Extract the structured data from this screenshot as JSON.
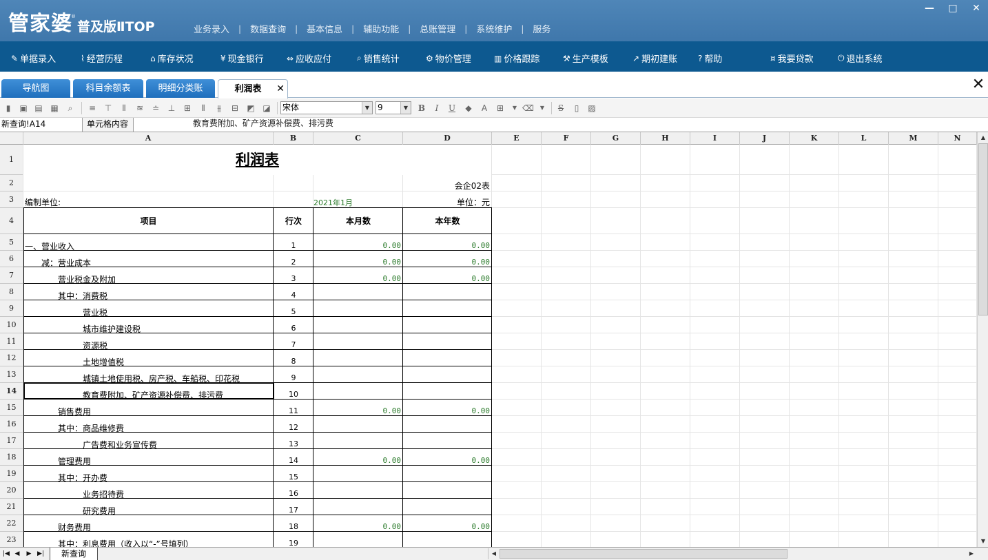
{
  "app": {
    "logo_main": "管家婆",
    "logo_sub": "普及版ⅡTOP",
    "logo_reg": "®"
  },
  "top_menu": [
    "业务录入",
    "数据查询",
    "基本信息",
    "辅助功能",
    "总账管理",
    "系统维护",
    "服务"
  ],
  "window_controls": {
    "minimize": "—",
    "maximize": "□",
    "close": "✕"
  },
  "nav": [
    {
      "label": "单据录入",
      "icon": "document-edit-icon",
      "glyph": "✎"
    },
    {
      "label": "经营历程",
      "icon": "chart-line-icon",
      "glyph": "⌇"
    },
    {
      "label": "库存状况",
      "icon": "house-icon",
      "glyph": "⌂"
    },
    {
      "label": "现金银行",
      "icon": "yen-icon",
      "glyph": "¥"
    },
    {
      "label": "应收应付",
      "icon": "swap-arrows-icon",
      "glyph": "⇔"
    },
    {
      "label": "销售统计",
      "icon": "magnifier-icon",
      "glyph": "⌕"
    },
    {
      "label": "物价管理",
      "icon": "gear-icon",
      "glyph": "⚙"
    },
    {
      "label": "价格跟踪",
      "icon": "bar-chart-icon",
      "glyph": "▥"
    },
    {
      "label": "生产模板",
      "icon": "wrench-icon",
      "glyph": "⚒"
    },
    {
      "label": "期初建账",
      "icon": "external-link-icon",
      "glyph": "↗"
    },
    {
      "label": "帮助",
      "icon": "question-icon",
      "glyph": "?"
    },
    {
      "label": "我要贷款",
      "icon": "money-bag-icon",
      "glyph": "¤"
    },
    {
      "label": "退出系统",
      "icon": "power-icon",
      "glyph": "⏻"
    }
  ],
  "tabs": [
    {
      "label": "导航图",
      "active": false
    },
    {
      "label": "科目余额表",
      "active": false
    },
    {
      "label": "明细分类账",
      "active": false
    },
    {
      "label": "利润表",
      "active": true
    }
  ],
  "tab_close_glyph": "✕",
  "panel_close_glyph": "✕",
  "format_toolbar": {
    "font": "宋体",
    "size": "9",
    "bold": "B",
    "italic": "I",
    "underline": "U",
    "strike": "S"
  },
  "formula_bar": {
    "cell_ref": "新查询!A14",
    "content_label": "单元格内容",
    "content_value": "教育费附加、矿产资源补偿费、排污费"
  },
  "columns": [
    "A",
    "B",
    "C",
    "D",
    "E",
    "F",
    "G",
    "H",
    "I",
    "J",
    "K",
    "L",
    "M",
    "N"
  ],
  "rows": [
    "1",
    "2",
    "3",
    "4",
    "5",
    "6",
    "7",
    "8",
    "9",
    "10",
    "11",
    "12",
    "13",
    "14",
    "15",
    "16",
    "17",
    "18",
    "19",
    "20",
    "21",
    "22",
    "23"
  ],
  "selected_row": "14",
  "report": {
    "title": "利润表",
    "form_code": "会企02表",
    "unit_label": "编制单位:",
    "period": "2021年1月",
    "currency": "单位：元",
    "headers": {
      "item": "项目",
      "line": "行次",
      "month": "本月数",
      "year": "本年数"
    },
    "lines": [
      {
        "item": "一、营业收入",
        "indent": 0,
        "no": "1",
        "month": "0.00",
        "year": "0.00"
      },
      {
        "item": "减：营业成本",
        "indent": 1,
        "no": "2",
        "month": "0.00",
        "year": "0.00"
      },
      {
        "item": "营业税金及附加",
        "indent": 2,
        "no": "3",
        "month": "0.00",
        "year": "0.00"
      },
      {
        "item": "其中：消费税",
        "indent": 2,
        "no": "4",
        "month": "",
        "year": ""
      },
      {
        "item": "营业税",
        "indent": 3,
        "no": "5",
        "month": "",
        "year": ""
      },
      {
        "item": "城市维护建设税",
        "indent": 3,
        "no": "6",
        "month": "",
        "year": ""
      },
      {
        "item": "资源税",
        "indent": 3,
        "no": "7",
        "month": "",
        "year": ""
      },
      {
        "item": "土地增值税",
        "indent": 3,
        "no": "8",
        "month": "",
        "year": ""
      },
      {
        "item": "城镇土地使用税、房产税、车船税、印花税",
        "indent": 3,
        "no": "9",
        "month": "",
        "year": ""
      },
      {
        "item": "教育费附加、矿产资源补偿费、排污费",
        "indent": 3,
        "no": "10",
        "month": "",
        "year": ""
      },
      {
        "item": "销售费用",
        "indent": 2,
        "no": "11",
        "month": "0.00",
        "year": "0.00"
      },
      {
        "item": "其中：商品维修费",
        "indent": 2,
        "no": "12",
        "month": "",
        "year": ""
      },
      {
        "item": "广告费和业务宣传费",
        "indent": 3,
        "no": "13",
        "month": "",
        "year": ""
      },
      {
        "item": "管理费用",
        "indent": 2,
        "no": "14",
        "month": "0.00",
        "year": "0.00"
      },
      {
        "item": "其中：开办费",
        "indent": 2,
        "no": "15",
        "month": "",
        "year": ""
      },
      {
        "item": "业务招待费",
        "indent": 3,
        "no": "16",
        "month": "",
        "year": ""
      },
      {
        "item": "研究费用",
        "indent": 3,
        "no": "17",
        "month": "",
        "year": ""
      },
      {
        "item": "财务费用",
        "indent": 2,
        "no": "18",
        "month": "0.00",
        "year": "0.00"
      },
      {
        "item": "其中：利息费用（收入以“-”号填列）",
        "indent": 2,
        "no": "19",
        "month": "",
        "year": ""
      }
    ]
  },
  "sheet_tabs": [
    "新查询"
  ],
  "colors": {
    "titlebar": "#4a82b6",
    "navbar": "#0d5990",
    "tab": "#2a7cc9",
    "number_green": "#2a7a2a"
  }
}
